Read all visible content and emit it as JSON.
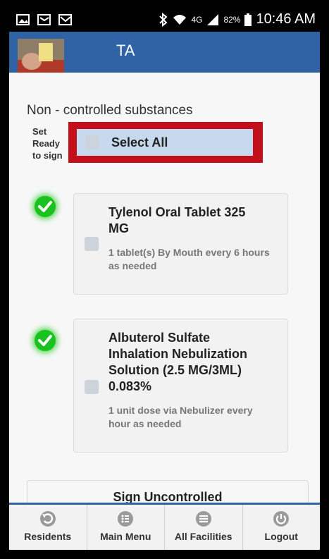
{
  "status_bar": {
    "battery": "82%",
    "time": "10:46 AM",
    "network": "4G"
  },
  "header": {
    "title": "TA"
  },
  "section": {
    "title": "Non - controlled substances"
  },
  "set_ready_label": "Set Ready to sign",
  "select_all": {
    "label": "Select All"
  },
  "medications": [
    {
      "name": "Tylenol Oral Tablet 325 MG",
      "directions": "1 tablet(s) By Mouth every 6 hours as needed"
    },
    {
      "name": "Albuterol Sulfate Inhalation Nebulization Solution (2.5 MG/3ML) 0.083%",
      "directions": "1 unit dose via Nebulizer every hour as needed"
    }
  ],
  "sign_button": "Sign Uncontrolled",
  "bottom_nav": [
    {
      "label": "Residents",
      "icon": "back-arrow-icon"
    },
    {
      "label": "Main Menu",
      "icon": "list-icon"
    },
    {
      "label": "All Facilities",
      "icon": "menu-lines-icon"
    },
    {
      "label": "Logout",
      "icon": "power-icon"
    }
  ],
  "colors": {
    "header_blue": "#2f63a6",
    "highlight_red": "#c20f1a",
    "check_green": "#19c21e",
    "select_bg": "#c7d9ee"
  }
}
